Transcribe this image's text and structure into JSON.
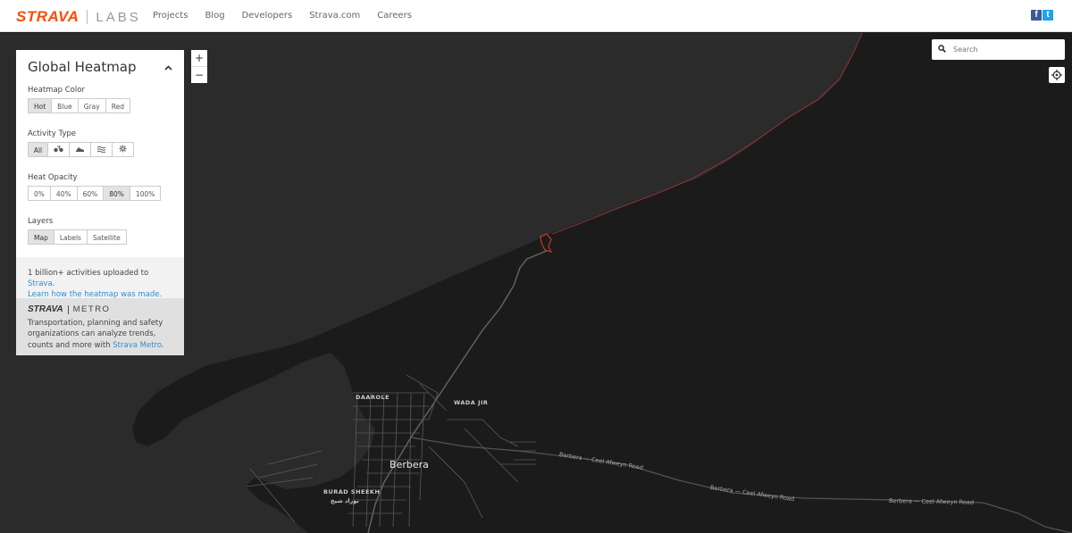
{
  "brand": {
    "name": "STRAVA",
    "sub": "LABS"
  },
  "nav": [
    "Projects",
    "Blog",
    "Developers",
    "Strava.com",
    "Careers"
  ],
  "social": {
    "facebook": "f",
    "twitter": "t"
  },
  "panel": {
    "title": "Global Heatmap",
    "heatmap_color": {
      "label": "Heatmap Color",
      "options": [
        "Hot",
        "Blue",
        "Gray",
        "Red"
      ],
      "selected": "Hot"
    },
    "activity_type": {
      "label": "Activity Type",
      "options": [
        "All",
        "ride-icon",
        "run-icon",
        "water-icon",
        "winter-icon"
      ],
      "selected": "All"
    },
    "heat_opacity": {
      "label": "Heat Opacity",
      "options": [
        "0%",
        "40%",
        "60%",
        "80%",
        "100%"
      ],
      "selected": "80%"
    },
    "layers": {
      "label": "Layers",
      "options": [
        "Map",
        "Labels",
        "Satellite"
      ],
      "selected": "Map"
    },
    "footer_text": "1 billion+ activities uploaded to ",
    "footer_link": "Strava",
    "footer_period": ".",
    "footer_link2": "Learn how the heatmap was made."
  },
  "metro": {
    "logo_strava": "STRAVA",
    "logo_word": "METRO",
    "text": "Transportation, planning and safety organizations can analyze trends, counts and more with ",
    "link": "Strava Metro",
    "period": "."
  },
  "zoom": {
    "in": "+",
    "out": "−"
  },
  "search": {
    "placeholder": "Search"
  },
  "map_labels": {
    "daarole": "DAAROLE",
    "wada_jir": "WADA JIR",
    "berbera": "Berbera",
    "burad_sheekh": "BURAD SHEEKH",
    "burad_arabic": "بوراد شيخ",
    "road1": "Berbera — Ceel Afweyn Road",
    "road2": "Berbera — Ceel Afweyn Road",
    "road3": "Berbera — Ceel Afweyn Road"
  },
  "colors": {
    "brand": "#fc4c02",
    "link": "#2d8fd0",
    "heat_trace": "#c0392b",
    "land": "#2a2a2a",
    "sea": "#1a1a1a"
  }
}
